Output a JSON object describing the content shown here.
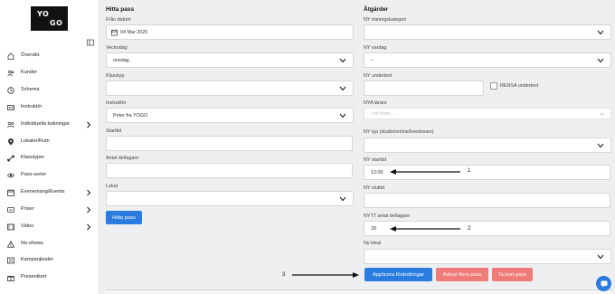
{
  "logo": {
    "line1": "YO",
    "line2": "GO"
  },
  "sidebar": {
    "items": [
      {
        "label": "Översikt",
        "icon": "home-icon",
        "has_chevron": false
      },
      {
        "label": "Kunder",
        "icon": "users-icon",
        "has_chevron": false
      },
      {
        "label": "Schema",
        "icon": "clock-icon",
        "has_chevron": false
      },
      {
        "label": "Instruktör",
        "icon": "id-card-icon",
        "has_chevron": false
      },
      {
        "label": "Individuella bokningar",
        "icon": "people-pair-icon",
        "has_chevron": true
      },
      {
        "label": "Lokaler/Rum",
        "icon": "map-pin-icon",
        "has_chevron": false
      },
      {
        "label": "Klasstyper",
        "icon": "dumbbell-icon",
        "has_chevron": false
      },
      {
        "label": "Pass-serier",
        "icon": "eye-icon",
        "has_chevron": false
      },
      {
        "label": "Evenemang/Events",
        "icon": "calendar-icon",
        "has_chevron": true
      },
      {
        "label": "Priser",
        "icon": "price-tag-icon",
        "has_chevron": true
      },
      {
        "label": "Video",
        "icon": "video-icon",
        "has_chevron": true
      },
      {
        "label": "No-shows",
        "icon": "warning-icon",
        "has_chevron": false
      },
      {
        "label": "Kampanjkoder",
        "icon": "coupon-icon",
        "has_chevron": false
      },
      {
        "label": "Presentkort",
        "icon": "gift-icon",
        "has_chevron": false
      }
    ]
  },
  "find": {
    "title": "Hitta pass",
    "from_date": {
      "label": "Från datum",
      "value": "04 Mar 2025"
    },
    "weekday": {
      "label": "Veckodag",
      "value": "onsdag"
    },
    "class_type": {
      "label": "Klasstyp",
      "value": ""
    },
    "instructor": {
      "label": "Instruktör",
      "value": "Peter fra YOGO"
    },
    "start_time": {
      "label": "Starttid",
      "value": ""
    },
    "participants": {
      "label": "Antal deltagare",
      "value": ""
    },
    "room": {
      "label": "Lokal",
      "value": ""
    },
    "button": "Hitta pass"
  },
  "actions": {
    "title": "Åtgärder",
    "new_class_type": {
      "label": "NY träningskategori",
      "value": ""
    },
    "new_weekday": {
      "label": "NY vardag",
      "value": "--"
    },
    "new_subtitle": {
      "label": "NY undertext",
      "value": ""
    },
    "clear_subtitle": {
      "label": "RENSA undertext",
      "checked": false
    },
    "new_teachers": {
      "label": "NYA lärare",
      "placeholder": "Välj lärare..."
    },
    "new_type": {
      "label": "NY typ (studio/online/livestream)",
      "value": ""
    },
    "new_start_time": {
      "label": "NY starttid",
      "value": "12:00"
    },
    "new_end_time": {
      "label": "NY sluttid",
      "value": ""
    },
    "new_participants": {
      "label": "NYTT antal deltagare",
      "value": "28"
    },
    "new_room": {
      "label": "Ny lokal",
      "value": ""
    },
    "apply_button": "Applicera förändringar",
    "cancel_button": "Avbryt flera pass",
    "delete_button": "Ta bort pass"
  },
  "annotations": {
    "arrow1": "1",
    "arrow2": "2",
    "arrow3": "3"
  },
  "colors": {
    "primary": "#2a7ce0",
    "danger": "#f07b78",
    "background": "#eeeff1"
  }
}
